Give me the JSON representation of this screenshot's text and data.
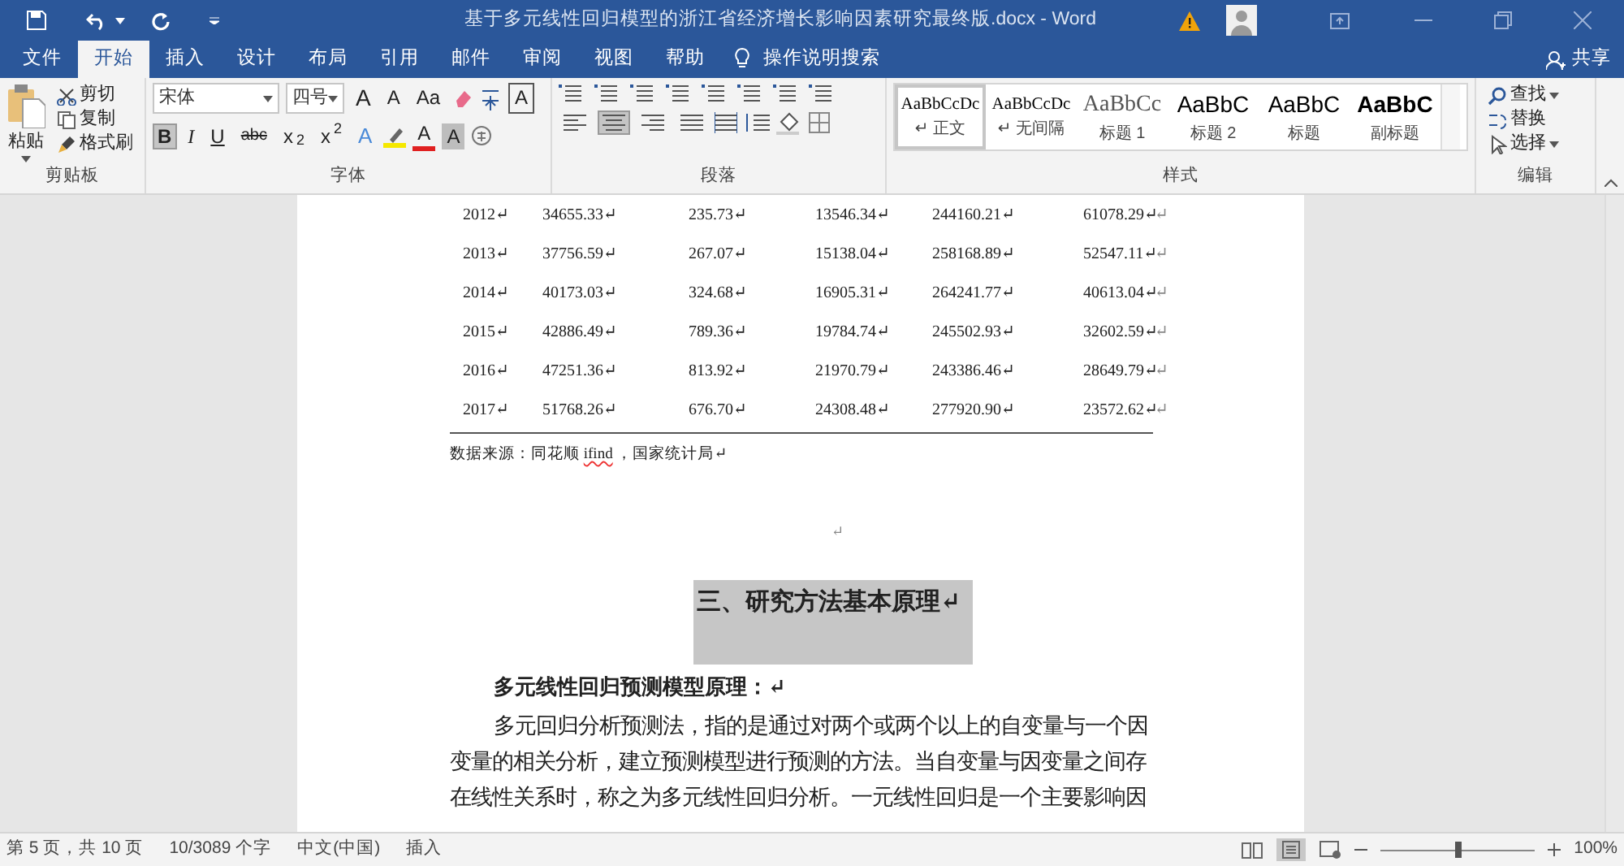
{
  "window": {
    "title": "基于多元线性回归模型的浙江省经济增长影响因素研究最终版.docx  -  Word"
  },
  "tabs": [
    {
      "label": "文件",
      "selected": false
    },
    {
      "label": "开始",
      "selected": true
    },
    {
      "label": "插入",
      "selected": false
    },
    {
      "label": "设计",
      "selected": false
    },
    {
      "label": "布局",
      "selected": false
    },
    {
      "label": "引用",
      "selected": false
    },
    {
      "label": "邮件",
      "selected": false
    },
    {
      "label": "审阅",
      "selected": false
    },
    {
      "label": "视图",
      "selected": false
    },
    {
      "label": "帮助",
      "selected": false
    }
  ],
  "tell_me": "操作说明搜索",
  "share": "共享",
  "clipboard": {
    "paste": "粘贴",
    "items": [
      "剪切",
      "复制",
      "格式刷"
    ],
    "label": "剪贴板"
  },
  "font": {
    "name": "宋体",
    "size": "四号",
    "row1": [
      {
        "kind": "grow",
        "label": "A",
        "selected": false
      },
      {
        "kind": "shrink",
        "label": "A",
        "selected": false
      },
      {
        "kind": "case",
        "label": "Aa",
        "selected": false
      },
      {
        "kind": "border",
        "label": "A",
        "selected": false
      }
    ],
    "row2": [
      {
        "kind": "bold",
        "label": "B",
        "selected": true
      },
      {
        "kind": "italic",
        "label": "I",
        "selected": false
      },
      {
        "kind": "underline",
        "label": "U",
        "selected": false
      },
      {
        "kind": "strike",
        "label": "abc",
        "selected": false
      },
      {
        "kind": "sub",
        "label": "x$_{2}$",
        "selected": false
      },
      {
        "kind": "sup",
        "label": "x$^{2}$",
        "selected": false
      },
      {
        "kind": "effects",
        "label": "A",
        "selected": false
      },
      {
        "kind": "color",
        "label": "A",
        "selected": false
      },
      {
        "kind": "shade",
        "label": "A",
        "selected": false
      }
    ],
    "label": "字体"
  },
  "paragraph": {
    "align": [
      {
        "selected": false
      },
      {
        "selected": true
      },
      {
        "selected": false
      },
      {
        "selected": false
      }
    ],
    "label": "段落"
  },
  "styles": {
    "items": [
      {
        "preview": "AaBbCcDc",
        "name": "↵ 正文",
        "kind": "serif",
        "selected": true
      },
      {
        "preview": "AaBbCcDc",
        "name": "↵ 无间隔",
        "kind": "serif",
        "selected": false
      },
      {
        "preview": "AaBbCc",
        "name": "标题 1",
        "kind": "light",
        "selected": false
      },
      {
        "preview": "AaBbC",
        "name": "标题 2",
        "kind": "sans",
        "selected": false
      },
      {
        "preview": "AaBbC",
        "name": "标题",
        "kind": "sans",
        "selected": false
      },
      {
        "preview": "AaBbC",
        "name": "副标题",
        "kind": "bold",
        "selected": false
      }
    ],
    "label": "样式"
  },
  "editing": {
    "items": [
      "查找",
      "替换",
      "选择"
    ],
    "label": "编辑"
  },
  "document": {
    "table_rows": [
      [
        "2012↵",
        "34655.33↵",
        "235.73↵",
        "13546.34↵",
        "244160.21↵",
        "61078.29↵",
        "↵"
      ],
      [
        "2013↵",
        "37756.59↵",
        "267.07↵",
        "15138.04↵",
        "258168.89↵",
        "52547.11↵",
        "↵"
      ],
      [
        "2014↵",
        "40173.03↵",
        "324.68↵",
        "16905.31↵",
        "264241.77↵",
        "40613.04↵",
        "↵"
      ],
      [
        "2015↵",
        "42886.49↵",
        "789.36↵",
        "19784.74↵",
        "245502.93↵",
        "32602.59↵",
        "↵"
      ],
      [
        "2016↵",
        "47251.36↵",
        "813.92↵",
        "21970.79↵",
        "243386.46↵",
        "28649.79↵",
        "↵"
      ],
      [
        "2017↵",
        "51768.26↵",
        "676.70↵",
        "24308.48↵",
        "277920.90↵",
        "23572.62↵",
        "↵"
      ]
    ],
    "source": [
      {
        "text": "数据来源：同花顺 ",
        "misspelled": false
      },
      {
        "text": "ifind",
        "misspelled": true
      },
      {
        "text": " ，国家统计局↵",
        "misspelled": false
      }
    ],
    "empty_mark": "↵",
    "heading": {
      "text": "三、研究方法基本原理↵",
      "selected": true
    },
    "subheading": "多元线性回归预测模型原理：↵",
    "body": "多元回归分析预测法，指的是通过对两个或两个以上的自变量与一个因变量的相关分析，建立预测模型进行预测的方法。当自变量与因变量之间存在线性关系时，称之为多元线性回归分析。一元线性回归是一个主要影响因"
  },
  "status_bar": {
    "page": "第 5 页，共 10 页",
    "words": "10/3089 个字",
    "language": "中文(中国)",
    "mode": "插入",
    "zoom": {
      "level": 0.5,
      "reading": "100%"
    }
  }
}
